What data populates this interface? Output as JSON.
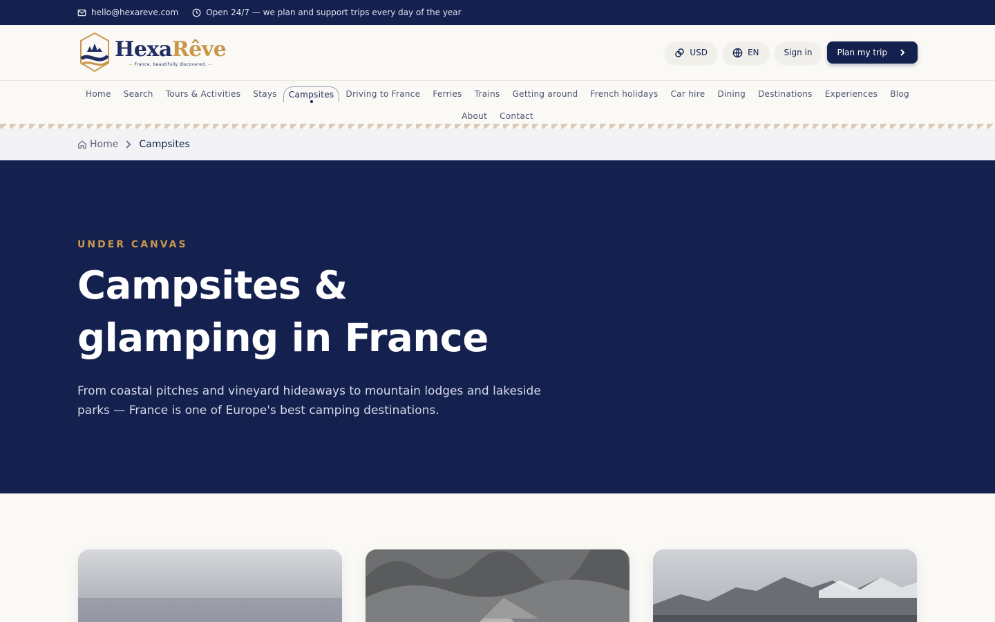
{
  "topbar": {
    "email": "hello@hexareve.com",
    "hours": "Open 24/7 — we plan and support trips every day of the year"
  },
  "brand": {
    "name_part1": "Hexa",
    "name_part2": "Rêve",
    "tagline": "France, beautifully discovered.",
    "colors": {
      "navy": "#14214f",
      "gold": "#c9974b"
    }
  },
  "header": {
    "currency": "USD",
    "language": "EN",
    "sign_in": "Sign in",
    "cta": "Plan my trip"
  },
  "nav": {
    "row1": [
      {
        "label": "Home"
      },
      {
        "label": "Search"
      },
      {
        "label": "Tours & Activities"
      },
      {
        "label": "Stays"
      },
      {
        "label": "Campsites",
        "active": true
      },
      {
        "label": "Driving to France"
      },
      {
        "label": "Ferries"
      },
      {
        "label": "Trains"
      },
      {
        "label": "Getting around"
      },
      {
        "label": "French holidays"
      },
      {
        "label": "Car hire"
      },
      {
        "label": "Dining"
      },
      {
        "label": "Destinations"
      },
      {
        "label": "Experiences"
      },
      {
        "label": "Blog"
      }
    ],
    "row2": [
      {
        "label": "About"
      },
      {
        "label": "Contact"
      }
    ]
  },
  "breadcrumb": {
    "home": "Home",
    "current": "Campsites"
  },
  "hero": {
    "eyebrow": "UNDER CANVAS",
    "title": "Campsites & glamping in France",
    "description": "From coastal pitches and vineyard hideaways to mountain lodges and lakeside parks — France is one of Europe's best camping destinations."
  }
}
